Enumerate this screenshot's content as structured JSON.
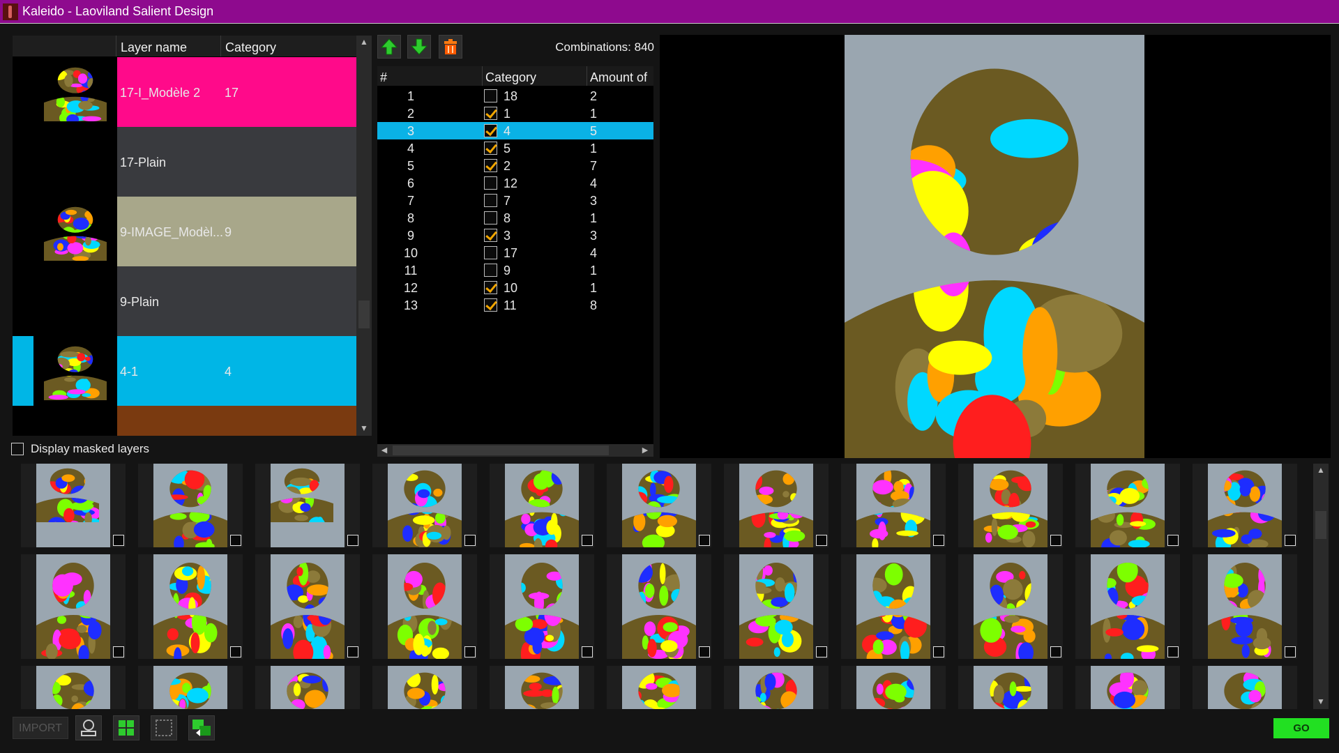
{
  "window": {
    "title": "Kaleido - Laoviland Salient Design"
  },
  "layers": {
    "headers": {
      "name": "Layer name",
      "category": "Category"
    },
    "rows": [
      {
        "name": "17-I_Modèle 2",
        "category": "17",
        "color": "#ff0a8a",
        "marker": ""
      },
      {
        "name": "17-Plain",
        "category": "",
        "color": "#393a3e",
        "marker": ""
      },
      {
        "name": "9-IMAGE_Modèl...",
        "category": "9",
        "color": "#a8a78a",
        "marker": ""
      },
      {
        "name": "9-Plain",
        "category": "",
        "color": "#393a3e",
        "marker": ""
      },
      {
        "name": "4-1",
        "category": "4",
        "color": "#00b6e6",
        "marker": "#00b6e6"
      },
      {
        "name": "",
        "category": "",
        "color": "#7a3a10",
        "marker": ""
      }
    ],
    "display_masked_label": "Display masked layers"
  },
  "toolbar": {
    "combinations": "Combinations: 840"
  },
  "categories": {
    "headers": {
      "num": "#",
      "category": "Category",
      "amount": "Amount of"
    },
    "rows": [
      {
        "num": "1",
        "checked": false,
        "category": "18",
        "amount": "2"
      },
      {
        "num": "2",
        "checked": true,
        "category": "1",
        "amount": "1"
      },
      {
        "num": "3",
        "checked": true,
        "category": "4",
        "amount": "5",
        "selected": true
      },
      {
        "num": "4",
        "checked": true,
        "category": "5",
        "amount": "1"
      },
      {
        "num": "5",
        "checked": true,
        "category": "2",
        "amount": "7"
      },
      {
        "num": "6",
        "checked": false,
        "category": "12",
        "amount": "4"
      },
      {
        "num": "7",
        "checked": false,
        "category": "7",
        "amount": "3"
      },
      {
        "num": "8",
        "checked": false,
        "category": "8",
        "amount": "1"
      },
      {
        "num": "9",
        "checked": true,
        "category": "3",
        "amount": "3"
      },
      {
        "num": "10",
        "checked": false,
        "category": "17",
        "amount": "4"
      },
      {
        "num": "11",
        "checked": false,
        "category": "9",
        "amount": "1"
      },
      {
        "num": "12",
        "checked": true,
        "category": "10",
        "amount": "1"
      },
      {
        "num": "13",
        "checked": true,
        "category": "11",
        "amount": "8"
      }
    ]
  },
  "bottom": {
    "import_label": "IMPORT",
    "go_label": "GO"
  },
  "icons": {
    "move_up": "arrow-up-icon",
    "move_down": "arrow-down-icon",
    "delete": "trash-icon",
    "export": "export-icon",
    "select_all": "select-all-icon",
    "deselect_all": "deselect-all-icon",
    "refresh": "refresh-icon"
  },
  "palette": [
    "#ff1e1e",
    "#00d8ff",
    "#7dff00",
    "#ff32ff",
    "#ffa000",
    "#1e2dff",
    "#ffff00",
    "#8c7a3a"
  ]
}
